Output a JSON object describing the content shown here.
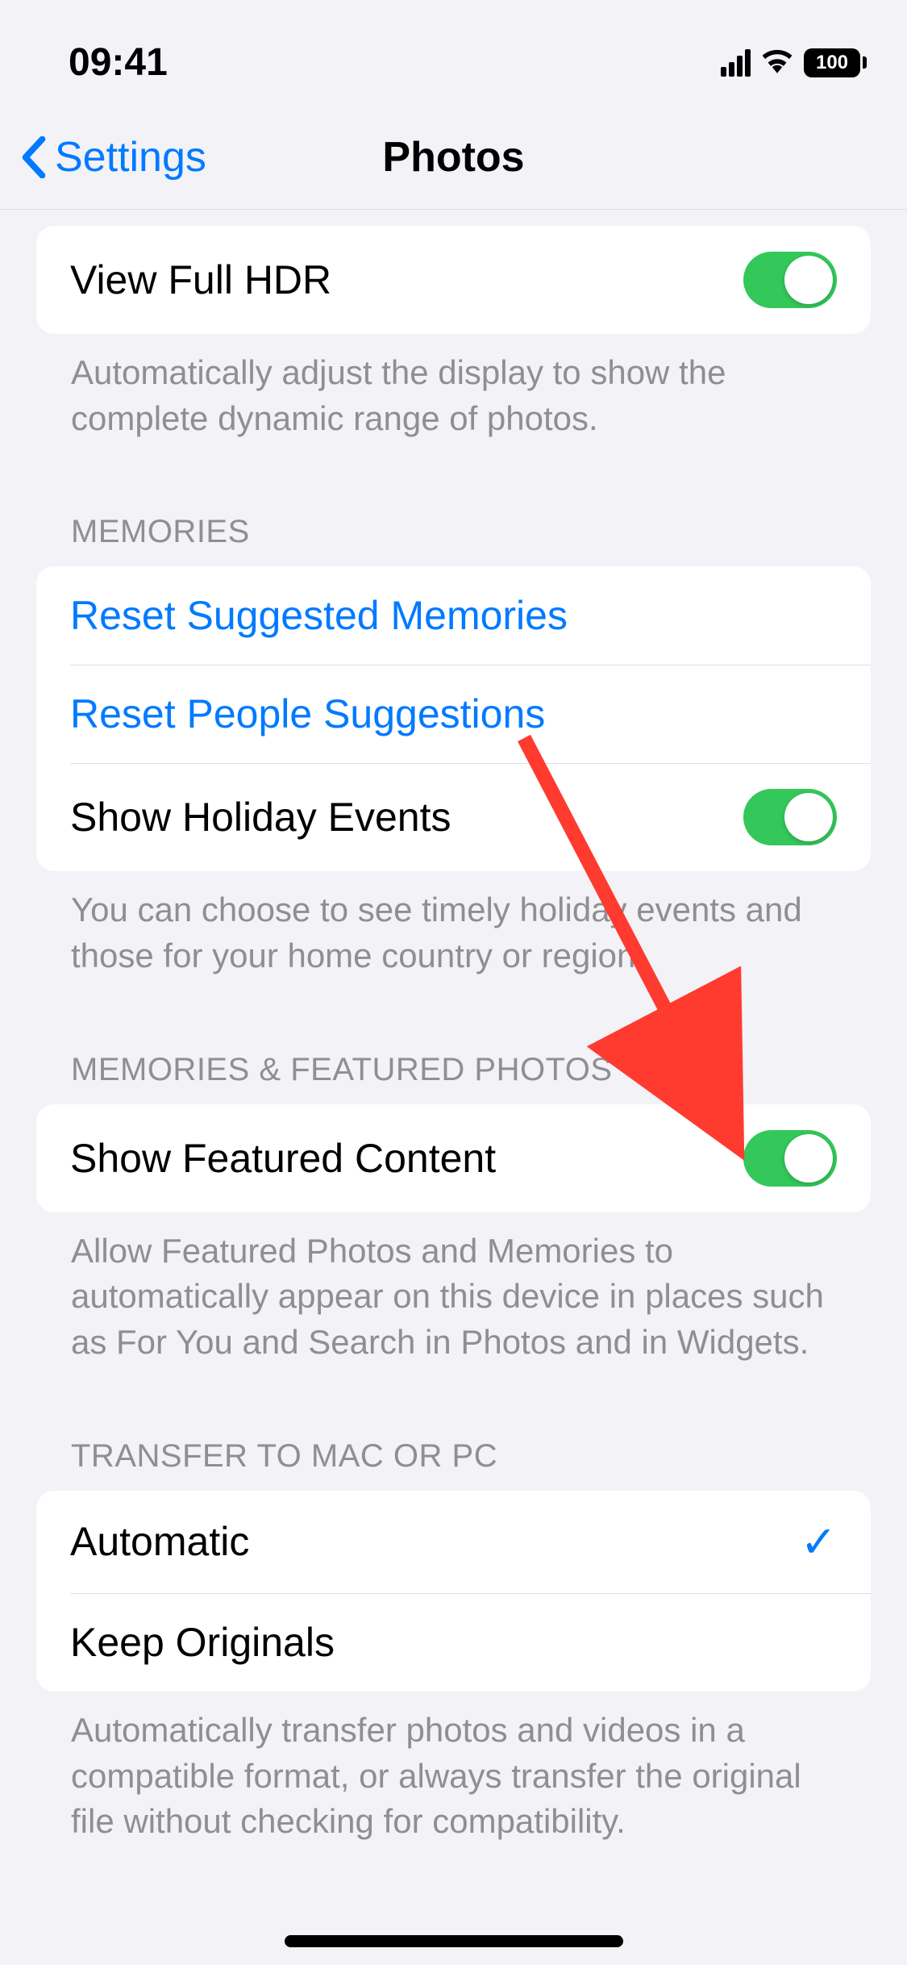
{
  "status_bar": {
    "time": "09:41",
    "battery": "100"
  },
  "nav": {
    "back_label": "Settings",
    "title": "Photos"
  },
  "hdr": {
    "label": "View Full HDR",
    "footer": "Automatically adjust the display to show the complete dynamic range of photos."
  },
  "memories": {
    "header": "MEMORIES",
    "reset_suggested": "Reset Suggested Memories",
    "reset_people": "Reset People Suggestions",
    "show_holiday": "Show Holiday Events",
    "footer": "You can choose to see timely holiday events and those for your home country or region."
  },
  "featured": {
    "header": "MEMORIES & FEATURED PHOTOS",
    "label": "Show Featured Content",
    "footer": "Allow Featured Photos and Memories to automatically appear on this device in places such as For You and Search in Photos and in Widgets."
  },
  "transfer": {
    "header": "TRANSFER TO MAC OR PC",
    "automatic": "Automatic",
    "keep_originals": "Keep Originals",
    "footer": "Automatically transfer photos and videos in a compatible format, or always transfer the original file without checking for compatibility."
  }
}
